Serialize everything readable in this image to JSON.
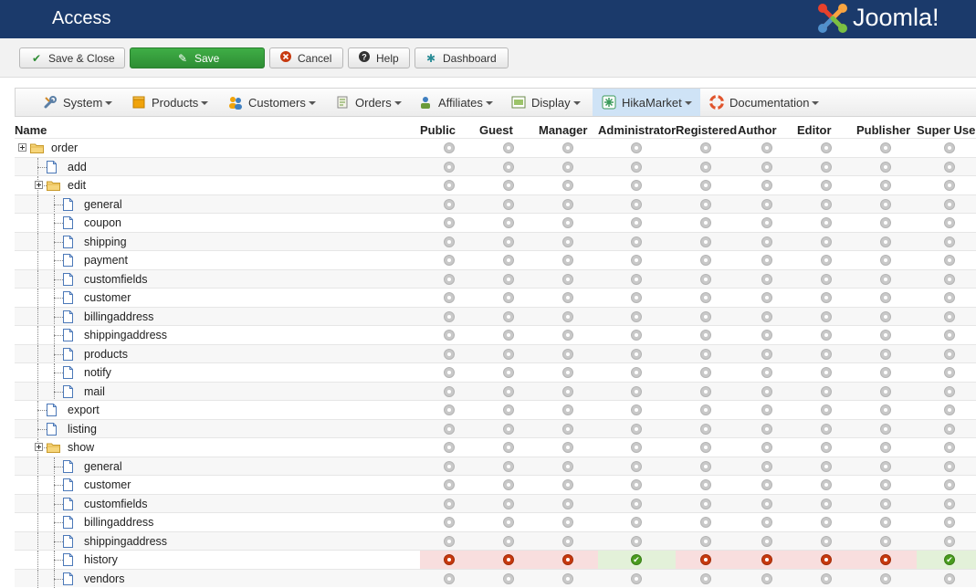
{
  "header": {
    "title": "Access",
    "logo_text": "Joomla!"
  },
  "toolbar": {
    "save_close": "Save & Close",
    "save": "Save",
    "cancel": "Cancel",
    "help": "Help",
    "dashboard": "Dashboard"
  },
  "menu": [
    {
      "label": "System",
      "icon": "wrench-icon",
      "active": false
    },
    {
      "label": "Products",
      "icon": "box-icon",
      "active": false
    },
    {
      "label": "Customers",
      "icon": "users-icon",
      "active": false
    },
    {
      "label": "Orders",
      "icon": "cart-icon",
      "active": false
    },
    {
      "label": "Affiliates",
      "icon": "affiliate-icon",
      "active": false
    },
    {
      "label": "Display",
      "icon": "display-icon",
      "active": false
    },
    {
      "label": "HikaMarket",
      "icon": "hikamarket-icon",
      "active": true
    },
    {
      "label": "Documentation",
      "icon": "lifebuoy-icon",
      "active": false
    }
  ],
  "table": {
    "name_header": "Name",
    "groups": [
      "Public",
      "Guest",
      "Manager",
      "Administrator",
      "Registered",
      "Author",
      "Editor",
      "Publisher",
      "Super Use"
    ],
    "rows": [
      {
        "label": "order",
        "type": "folder",
        "depth": 0,
        "state": "none"
      },
      {
        "label": "add",
        "type": "page",
        "depth": 1,
        "state": "none"
      },
      {
        "label": "edit",
        "type": "folder",
        "depth": 1,
        "state": "none"
      },
      {
        "label": "general",
        "type": "page",
        "depth": 2,
        "state": "none"
      },
      {
        "label": "coupon",
        "type": "page",
        "depth": 2,
        "state": "none"
      },
      {
        "label": "shipping",
        "type": "page",
        "depth": 2,
        "state": "none"
      },
      {
        "label": "payment",
        "type": "page",
        "depth": 2,
        "state": "none"
      },
      {
        "label": "customfields",
        "type": "page",
        "depth": 2,
        "state": "none"
      },
      {
        "label": "customer",
        "type": "page",
        "depth": 2,
        "state": "none"
      },
      {
        "label": "billingaddress",
        "type": "page",
        "depth": 2,
        "state": "none"
      },
      {
        "label": "shippingaddress",
        "type": "page",
        "depth": 2,
        "state": "none"
      },
      {
        "label": "products",
        "type": "page",
        "depth": 2,
        "state": "none"
      },
      {
        "label": "notify",
        "type": "page",
        "depth": 2,
        "state": "none"
      },
      {
        "label": "mail",
        "type": "page",
        "depth": 2,
        "state": "none"
      },
      {
        "label": "export",
        "type": "page",
        "depth": 1,
        "state": "none"
      },
      {
        "label": "listing",
        "type": "page",
        "depth": 1,
        "state": "none"
      },
      {
        "label": "show",
        "type": "folder",
        "depth": 1,
        "state": "none"
      },
      {
        "label": "general",
        "type": "page",
        "depth": 2,
        "state": "none"
      },
      {
        "label": "customer",
        "type": "page",
        "depth": 2,
        "state": "none"
      },
      {
        "label": "customfields",
        "type": "page",
        "depth": 2,
        "state": "none"
      },
      {
        "label": "billingaddress",
        "type": "page",
        "depth": 2,
        "state": "none"
      },
      {
        "label": "shippingaddress",
        "type": "page",
        "depth": 2,
        "state": "none"
      },
      {
        "label": "history",
        "type": "page",
        "depth": 2,
        "state": "set",
        "values": [
          "deny",
          "deny",
          "deny",
          "allow",
          "deny",
          "deny",
          "deny",
          "deny",
          "allow"
        ]
      },
      {
        "label": "vendors",
        "type": "page",
        "depth": 2,
        "state": "none"
      }
    ]
  },
  "colors": {
    "header_bg": "#1b3a6b",
    "save_green": "#3fae46",
    "deny": "#c7390f",
    "allow": "#4a9c1f",
    "active_menu": "#cfe3f6"
  }
}
